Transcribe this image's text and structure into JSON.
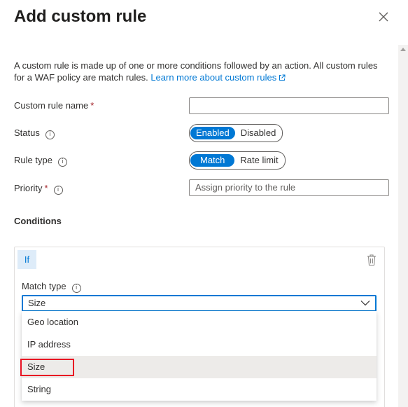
{
  "panel": {
    "title": "Add custom rule"
  },
  "description": {
    "text": "A custom rule is made up of one or more conditions followed by an action. All custom rules for a WAF policy are match rules. ",
    "link": "Learn more about custom rules"
  },
  "fields": {
    "name_label": "Custom rule name",
    "name_required": "*",
    "name_value": "",
    "status_label": "Status",
    "status_options": [
      "Enabled",
      "Disabled"
    ],
    "status_selected": "Enabled",
    "ruletype_label": "Rule type",
    "ruletype_options": [
      "Match",
      "Rate limit"
    ],
    "ruletype_selected": "Match",
    "priority_label": "Priority",
    "priority_required": "*",
    "priority_placeholder": "Assign priority to the rule"
  },
  "conditions": {
    "title": "Conditions",
    "if_label": "If",
    "match_type_label": "Match type",
    "match_type_value": "Size",
    "options": [
      "Geo location",
      "IP address",
      "Size",
      "String"
    ],
    "highlighted_option": "Size"
  },
  "colors": {
    "accent": "#0078d4",
    "highlight_border": "#e81123",
    "required": "#a4262c"
  },
  "icons": [
    "close-icon",
    "info-icon",
    "external-link-icon",
    "trash-icon",
    "chevron-down-icon"
  ]
}
